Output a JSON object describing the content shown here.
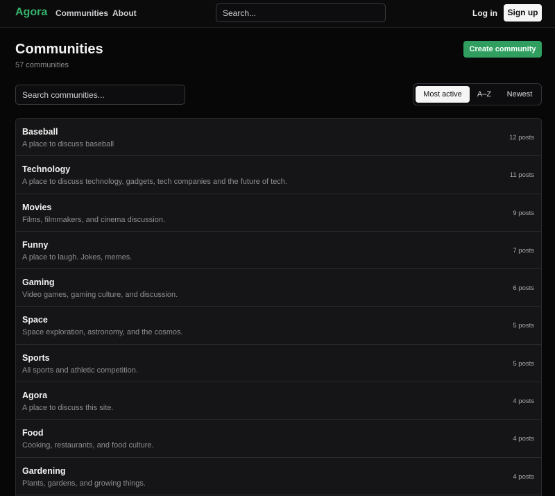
{
  "nav": {
    "brand": "Agora",
    "links": [
      "Communities",
      "About"
    ],
    "search_placeholder": "Search...",
    "login": "Log in",
    "signup": "Sign up"
  },
  "header": {
    "title": "Communities",
    "count": "57 communities",
    "create_button": "Create community"
  },
  "filters": {
    "search_placeholder": "Search communities...",
    "sort_options": [
      "Most active",
      "A–Z",
      "Newest"
    ],
    "active_sort": "Most active"
  },
  "communities": [
    {
      "name": "Baseball",
      "description": "A place to discuss baseball",
      "posts": "12 posts"
    },
    {
      "name": "Technology",
      "description": "A place to discuss technology, gadgets, tech companies and the future of tech.",
      "posts": "11 posts"
    },
    {
      "name": "Movies",
      "description": "Films, filmmakers, and cinema discussion.",
      "posts": "9 posts"
    },
    {
      "name": "Funny",
      "description": "A place to laugh. Jokes, memes.",
      "posts": "7 posts"
    },
    {
      "name": "Gaming",
      "description": "Video games, gaming culture, and discussion.",
      "posts": "6 posts"
    },
    {
      "name": "Space",
      "description": "Space exploration, astronomy, and the cosmos.",
      "posts": "5 posts"
    },
    {
      "name": "Sports",
      "description": "All sports and athletic competition.",
      "posts": "5 posts"
    },
    {
      "name": "Agora",
      "description": "A place to discuss this site.",
      "posts": "4 posts"
    },
    {
      "name": "Food",
      "description": "Cooking, restaurants, and food culture.",
      "posts": "4 posts"
    },
    {
      "name": "Gardening",
      "description": "Plants, gardens, and growing things.",
      "posts": "4 posts"
    }
  ],
  "colors": {
    "accent": "#35b36b",
    "create_button": "#2f9e5f",
    "background": "#070707",
    "card": "#151517"
  }
}
